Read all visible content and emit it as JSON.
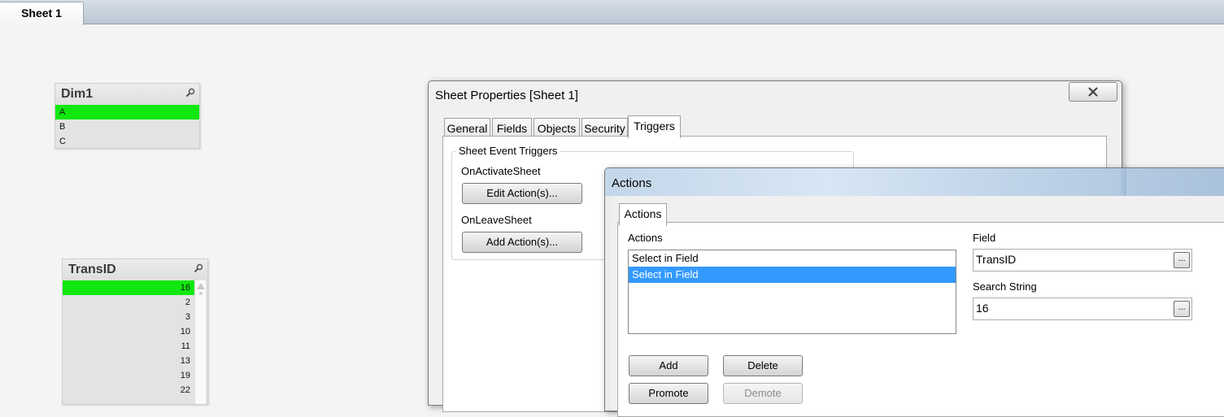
{
  "sheet_tabs": [
    {
      "label": "Sheet 1"
    }
  ],
  "listbox_dim1": {
    "title": "Dim1",
    "rows": [
      {
        "value": "A",
        "selected": true
      },
      {
        "value": "B",
        "selected": false
      },
      {
        "value": "C",
        "selected": false
      }
    ]
  },
  "listbox_transid": {
    "title": "TransID",
    "rows": [
      "16",
      "2",
      "3",
      "10",
      "11",
      "13",
      "19",
      "22"
    ],
    "selected_value": "16"
  },
  "sheet_properties": {
    "title": "Sheet Properties [Sheet 1]",
    "tabs": [
      "General",
      "Fields",
      "Objects",
      "Security",
      "Triggers"
    ],
    "active_tab": "Triggers",
    "group_label": "Sheet Event Triggers",
    "on_activate_label": "OnActivateSheet",
    "edit_actions_label": "Edit Action(s)...",
    "on_leave_label": "OnLeaveSheet",
    "add_actions_label": "Add Action(s)..."
  },
  "actions_dialog": {
    "title": "Actions",
    "tab_label": "Actions",
    "actions_list_label": "Actions",
    "actions": [
      "Select in Field",
      "Select in Field"
    ],
    "selected_index": 1,
    "field_label": "Field",
    "field_value": "TransID",
    "search_string_label": "Search String",
    "search_string_value": "16",
    "browse_label": "...",
    "add_label": "Add",
    "delete_label": "Delete",
    "promote_label": "Promote",
    "demote_label": "Demote"
  },
  "colors": {
    "selected_green": "#10e810",
    "selected_blue": "#3399ff"
  }
}
